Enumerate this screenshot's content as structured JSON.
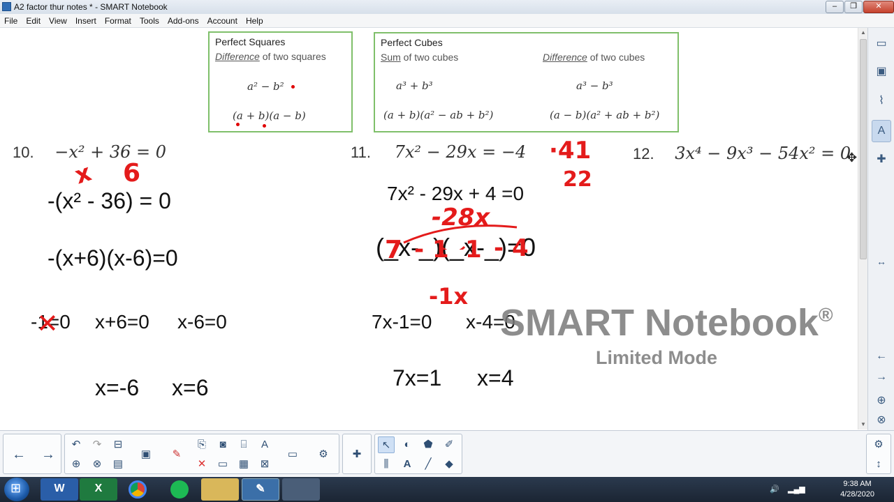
{
  "window": {
    "title": "A2 factor thur notes * - SMART Notebook",
    "controls": [
      "–",
      "❐",
      "✕"
    ]
  },
  "menu": [
    "File",
    "Edit",
    "View",
    "Insert",
    "Format",
    "Tools",
    "Add-ons",
    "Account",
    "Help"
  ],
  "squares_box": {
    "title": "Perfect Squares",
    "subtitle_em": "Difference",
    "subtitle_rest": " of two squares",
    "formula": "a² − b²",
    "factored": "(a + b)(a − b)"
  },
  "cubes_box": {
    "title": "Perfect Cubes",
    "sum_em": "Sum",
    "sum_rest": " of two cubes",
    "diff_em": "Difference",
    "diff_rest": " of two cubes",
    "sum_formula": "a³ + b³",
    "diff_formula": "a³ − b³",
    "sum_factored": "(a + b)(a² − ab + b²)",
    "diff_factored": "(a − b)(a² + ab + b²)"
  },
  "problems": [
    {
      "number": "10.",
      "equation": "−x² + 36 = 0"
    },
    {
      "number": "11.",
      "equation": "7x² − 29x = −4"
    },
    {
      "number": "12.",
      "equation": "3x⁴ − 9x³ − 54x² = 0"
    }
  ],
  "work10": {
    "line1": "-(x² - 36) = 0",
    "line2": "-(x+6)(x-6)=0",
    "struck": "-1=0",
    "line3a": "x+6=0",
    "line3b": "x-6=0",
    "line4a": "x=-6",
    "line4b": "x=6"
  },
  "work11": {
    "line1": "7x² - 29x + 4 =0",
    "line2": "(_x-_)(_x-_)=0",
    "line3a": "7x-1=0",
    "line3b": "x-4=0",
    "line4a": "7x=1",
    "line4b": "x=4"
  },
  "ink": {
    "n10_a": "x",
    "n10_b": "6",
    "n11_a": "·41",
    "n11_b": "22",
    "n11_c": "-28x",
    "n11_d": "7",
    "n11_e": "- 1",
    "n11_f": "1",
    "n11_g": "- 4",
    "n11_h": "-1x",
    "n10_x": "✕"
  },
  "watermark": {
    "line1": "SMART Notebook",
    "reg": "®",
    "line2": "Limited Mode"
  },
  "tray": {
    "time": "9:38 AM",
    "date": "4/28/2020"
  },
  "taskbar_apps": [
    "W",
    "X",
    "",
    "",
    "",
    "",
    ""
  ]
}
